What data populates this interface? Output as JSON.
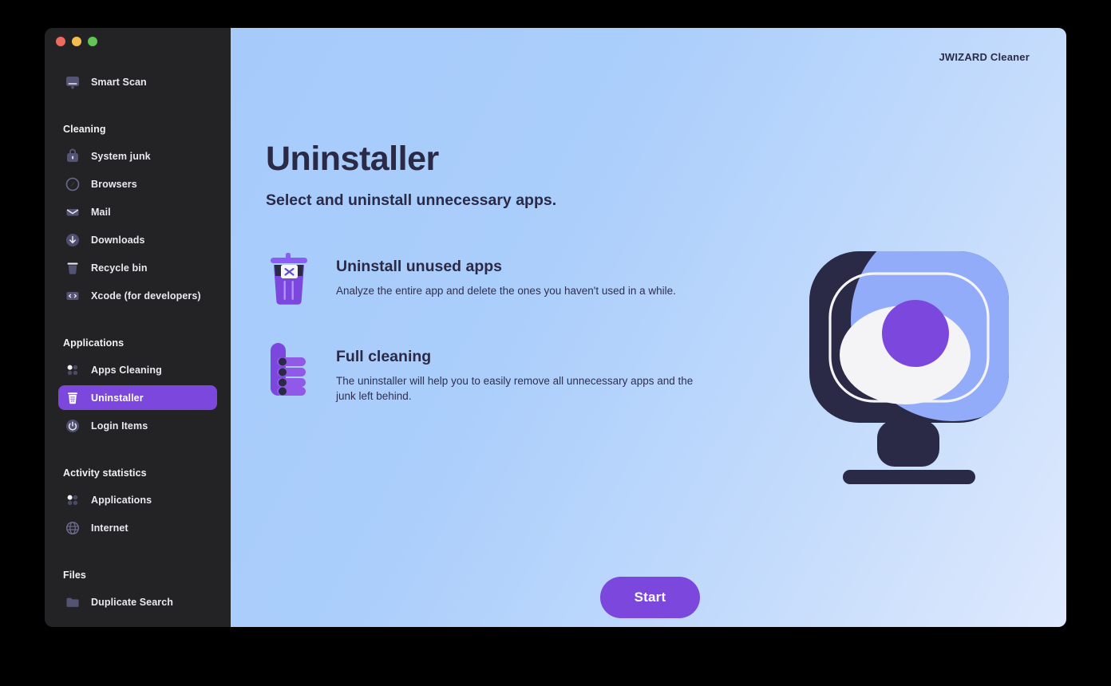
{
  "window": {
    "traffic_lights": [
      {
        "name": "close",
        "color": "#ED6A5F"
      },
      {
        "name": "minimize",
        "color": "#F4BE4F"
      },
      {
        "name": "maximize",
        "color": "#61C554"
      }
    ]
  },
  "sidebar": {
    "top_item": {
      "label": "Smart Scan",
      "icon": "monitor-icon"
    },
    "groups": [
      {
        "title": "Cleaning",
        "items": [
          {
            "label": "System junk",
            "icon": "lock-bag-icon",
            "selected": false
          },
          {
            "label": "Browsers",
            "icon": "browser-compass-icon",
            "selected": false
          },
          {
            "label": "Mail",
            "icon": "envelope-icon",
            "selected": false
          },
          {
            "label": "Downloads",
            "icon": "download-arrow-icon",
            "selected": false
          },
          {
            "label": "Recycle bin",
            "icon": "trash-bin-icon",
            "selected": false
          },
          {
            "label": "Xcode (for developers)",
            "icon": "code-brackets-icon",
            "selected": false
          }
        ]
      },
      {
        "title": "Applications",
        "items": [
          {
            "label": "Apps Cleaning",
            "icon": "four-dots-icon",
            "selected": false
          },
          {
            "label": "Uninstaller",
            "icon": "uninstall-trash-icon",
            "selected": true
          },
          {
            "label": "Login Items",
            "icon": "power-icon",
            "selected": false
          }
        ]
      },
      {
        "title": "Activity statistics",
        "items": [
          {
            "label": "Applications",
            "icon": "four-dots-icon",
            "selected": false
          },
          {
            "label": "Internet",
            "icon": "globe-icon",
            "selected": false
          }
        ]
      },
      {
        "title": "Files",
        "items": [
          {
            "label": "Duplicate Search",
            "icon": "folder-icon",
            "selected": false
          }
        ]
      }
    ]
  },
  "main": {
    "brand": "JWIZARD Cleaner",
    "title": "Uninstaller",
    "subtitle": "Select and uninstall unnecessary apps.",
    "features": [
      {
        "icon": "trash-x-icon",
        "title": "Uninstall unused apps",
        "description": "Analyze the entire app and delete the ones you haven't used in a while."
      },
      {
        "icon": "list-hand-icon",
        "title": "Full cleaning",
        "description": "The uninstaller will help you to easily remove all unnecessary apps and the junk left behind."
      }
    ],
    "illustration": {
      "name": "monitor-circles-illustration"
    },
    "start_button": "Start"
  },
  "colors": {
    "accent_purple": "#7B47DD",
    "sidebar_bg": "#232326",
    "panel_gradient_from": "#A6CBFB",
    "panel_gradient_to": "#DEE9FD",
    "dark_navy": "#2A2A46",
    "illustration_blue": "#92ACFA",
    "illustration_white": "#F4F4F6",
    "illustration_purple": "#7B47DD"
  }
}
